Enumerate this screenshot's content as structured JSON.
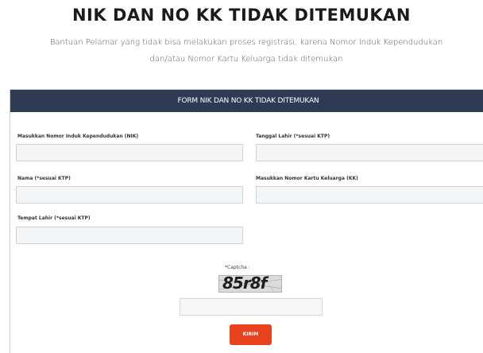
{
  "page": {
    "title": "NIK DAN NO KK TIDAK DITEMUKAN",
    "description": "Bantuan Pelamar yang tidak bisa melakukan proses registrasi, karena Nomor Induk Kependudukan dan/atau Nomor Kartu Keluarga tidak ditemukan"
  },
  "form": {
    "header": "FORM NIK DAN NO KK TIDAK DITEMUKAN",
    "fields": {
      "nik_label": "Masukkan Nomor Induk Kependudukan (NIK)",
      "tanggal_lahir_label": "Tanggal Lahir (*sesuai KTP)",
      "nama_label": "Nama (*sesuai KTP)",
      "no_kk_label": "Masukkan Nomor Kartu Keluarga (KK)",
      "tempat_lahir_label": "Tempat Lahir (*sesuai KTP)"
    },
    "captcha": {
      "label": "*Captcha :",
      "code": "85r8f"
    },
    "submit_label": "KIRIM"
  },
  "colors": {
    "header_bg": "#2f3a55",
    "submit_bg": "#e8431c"
  }
}
